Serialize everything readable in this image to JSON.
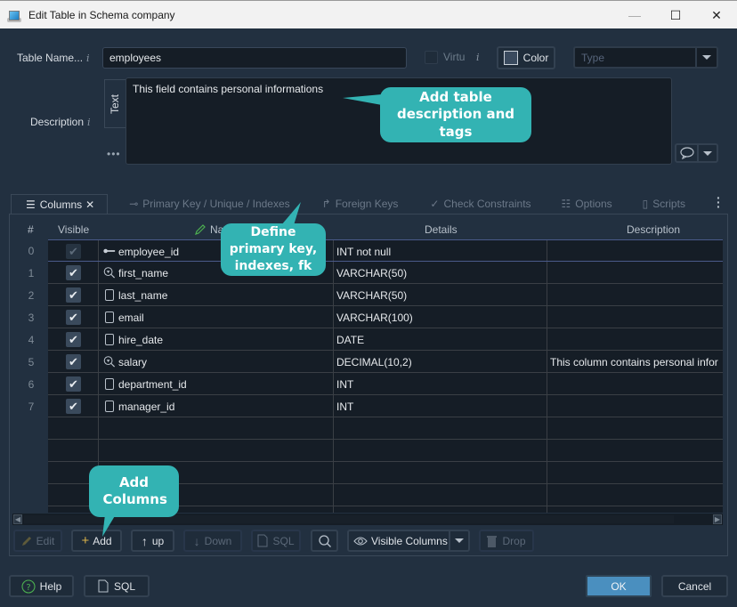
{
  "window": {
    "title": "Edit Table in Schema company",
    "controls": {
      "minimize": "—",
      "maximize": "☐",
      "close": "✕"
    }
  },
  "form": {
    "table_name_label": "Table Name...",
    "table_name_value": "employees",
    "info_glyph": "i",
    "virtual_label": "Virtu",
    "virtual_checked": false,
    "color_button": "Color",
    "type_placeholder": "Type",
    "description_label": "Description",
    "description_mode_tab": "Text",
    "more_glyph": "•••",
    "description_value": "This field contains personal informations"
  },
  "tabs": [
    {
      "label": "Columns",
      "icon": "list-icon",
      "glyph": "☰",
      "active": true,
      "closable": "✕"
    },
    {
      "label": "Primary Key / Unique / Indexes",
      "icon": "key-icon",
      "glyph": "⊸",
      "active": false
    },
    {
      "label": "Foreign Keys",
      "icon": "arrow-turn-icon",
      "glyph": "↱",
      "active": false
    },
    {
      "label": "Check Constraints",
      "icon": "check-circle-icon",
      "glyph": "✓",
      "active": false
    },
    {
      "label": "Options",
      "icon": "options-icon",
      "glyph": "☷",
      "active": false
    },
    {
      "label": "Scripts",
      "icon": "sql-file-icon",
      "glyph": "▯",
      "active": false
    }
  ],
  "grid": {
    "headers": {
      "num": "#",
      "visible": "Visible",
      "name": "Name",
      "details": "Details",
      "description": "Description"
    },
    "rows": [
      {
        "num": "0",
        "visible": true,
        "dim": true,
        "icon": "key",
        "name": "employee_id",
        "details": "INT not null",
        "description": ""
      },
      {
        "num": "1",
        "visible": true,
        "icon": "index",
        "name": "first_name",
        "details": "VARCHAR(50)",
        "description": ""
      },
      {
        "num": "2",
        "visible": true,
        "icon": "column",
        "name": "last_name",
        "details": "VARCHAR(50)",
        "description": ""
      },
      {
        "num": "3",
        "visible": true,
        "icon": "column",
        "name": "email",
        "details": "VARCHAR(100)",
        "description": ""
      },
      {
        "num": "4",
        "visible": true,
        "icon": "column",
        "name": "hire_date",
        "details": "DATE",
        "description": ""
      },
      {
        "num": "5",
        "visible": true,
        "icon": "index",
        "name": "salary",
        "details": "DECIMAL(10,2)",
        "description": "This column contains personal infor"
      },
      {
        "num": "6",
        "visible": true,
        "icon": "column",
        "name": "department_id",
        "details": "INT",
        "description": ""
      },
      {
        "num": "7",
        "visible": true,
        "icon": "column",
        "name": "manager_id",
        "details": "INT",
        "description": ""
      }
    ]
  },
  "toolbar": {
    "edit": "Edit",
    "add": "Add",
    "up": "up",
    "down": "Down",
    "sql": "SQL",
    "visible_columns": "Visible Columns",
    "drop": "Drop"
  },
  "footer": {
    "help": "Help",
    "sql": "SQL",
    "ok": "OK",
    "cancel": "Cancel"
  },
  "callouts": {
    "description": "Add table description and tags",
    "keys": "Define primary key, indexes, fk",
    "add_columns": "Add Columns"
  },
  "colors": {
    "background": "#223040",
    "callout": "#33b3b3",
    "ok_button": "#4a8fbf",
    "grid_background": "#151d26"
  }
}
